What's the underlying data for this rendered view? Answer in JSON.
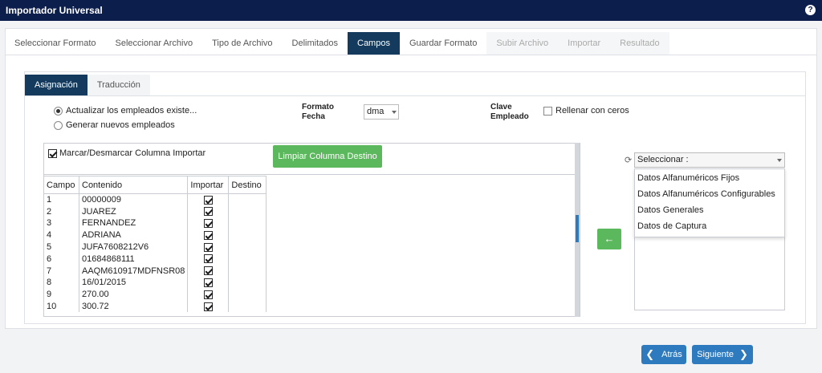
{
  "app": {
    "title": "Importador Universal",
    "help_icon": "question-icon"
  },
  "main_tabs": [
    {
      "label": "Seleccionar Formato",
      "state": "normal"
    },
    {
      "label": "Seleccionar Archivo",
      "state": "normal"
    },
    {
      "label": "Tipo de Archivo",
      "state": "normal"
    },
    {
      "label": "Delimitados",
      "state": "normal"
    },
    {
      "label": "Campos",
      "state": "active"
    },
    {
      "label": "Guardar Formato",
      "state": "normal"
    },
    {
      "label": "Subir Archivo",
      "state": "disabled"
    },
    {
      "label": "Importar",
      "state": "disabled"
    },
    {
      "label": "Resultado",
      "state": "disabled"
    }
  ],
  "sub_tabs": [
    {
      "label": "Asignación",
      "state": "active"
    },
    {
      "label": "Traducción",
      "state": "normal"
    }
  ],
  "options": {
    "radio_update": "Actualizar los empleados existe...",
    "radio_new": "Generar nuevos empleados",
    "formato_fecha_label": "Formato Fecha",
    "formato_fecha_value": "dma",
    "clave_empleado_label": "Clave Empleado",
    "rellenar_label": "Rellenar con ceros"
  },
  "left": {
    "toggle_label": "Marcar/Desmarcar Columna Importar",
    "clear_button": "Limpiar Columna Destino",
    "headers": {
      "campo": "Campo",
      "contenido": "Contenido",
      "importar": "Importar",
      "destino": "Destino"
    },
    "rows": [
      {
        "campo": "1",
        "contenido": "00000009"
      },
      {
        "campo": "2",
        "contenido": "JUAREZ"
      },
      {
        "campo": "3",
        "contenido": "FERNANDEZ"
      },
      {
        "campo": "4",
        "contenido": "ADRIANA"
      },
      {
        "campo": "5",
        "contenido": "JUFA7608212V6"
      },
      {
        "campo": "6",
        "contenido": "01684868111"
      },
      {
        "campo": "7",
        "contenido": "AAQM610917MDFNSR08"
      },
      {
        "campo": "8",
        "contenido": "16/01/2015"
      },
      {
        "campo": "9",
        "contenido": "270.00"
      },
      {
        "campo": "10",
        "contenido": "300.72"
      }
    ]
  },
  "right": {
    "select_placeholder": "Seleccionar :",
    "dropdown_options": [
      "Datos Alfanuméricos Fijos",
      "Datos Alfanuméricos Configurables",
      "Datos Generales",
      "Datos de Captura"
    ],
    "assign_arrow": "←"
  },
  "nav": {
    "back": "Atrás",
    "next": "Siguiente"
  }
}
